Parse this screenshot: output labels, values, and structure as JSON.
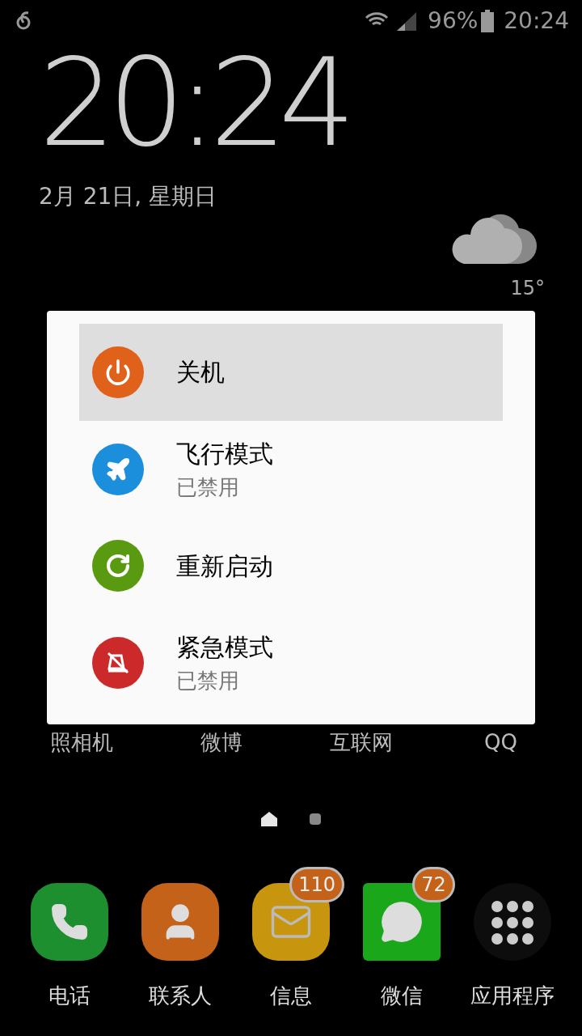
{
  "status_bar": {
    "battery": "96%",
    "time": "20:24"
  },
  "clock": {
    "time": "20:24",
    "date": "2月 21日, 星期日"
  },
  "weather": {
    "high": "15°"
  },
  "home_apps": [
    {
      "label": "照相机"
    },
    {
      "label": "微博"
    },
    {
      "label": "互联网"
    },
    {
      "label": "QQ"
    }
  ],
  "pages": [
    {
      "kind": "home",
      "selected": true
    },
    {
      "kind": "page",
      "selected": false
    }
  ],
  "power_menu": {
    "items": [
      {
        "kind": "power",
        "label": "关机",
        "selected": true
      },
      {
        "kind": "airplane",
        "label": "飞行模式",
        "status": "已禁用",
        "selected": false
      },
      {
        "kind": "restart",
        "label": "重新启动",
        "selected": false
      },
      {
        "kind": "emergency",
        "label": "紧急模式",
        "status": "已禁用",
        "selected": false
      }
    ]
  },
  "dock": [
    {
      "kind": "phone",
      "label": "电话"
    },
    {
      "kind": "contacts",
      "label": "联系人"
    },
    {
      "kind": "messages",
      "label": "信息",
      "badge": "110"
    },
    {
      "kind": "chat",
      "label": "微信",
      "badge": "72"
    },
    {
      "kind": "apps",
      "label": "应用程序"
    }
  ]
}
